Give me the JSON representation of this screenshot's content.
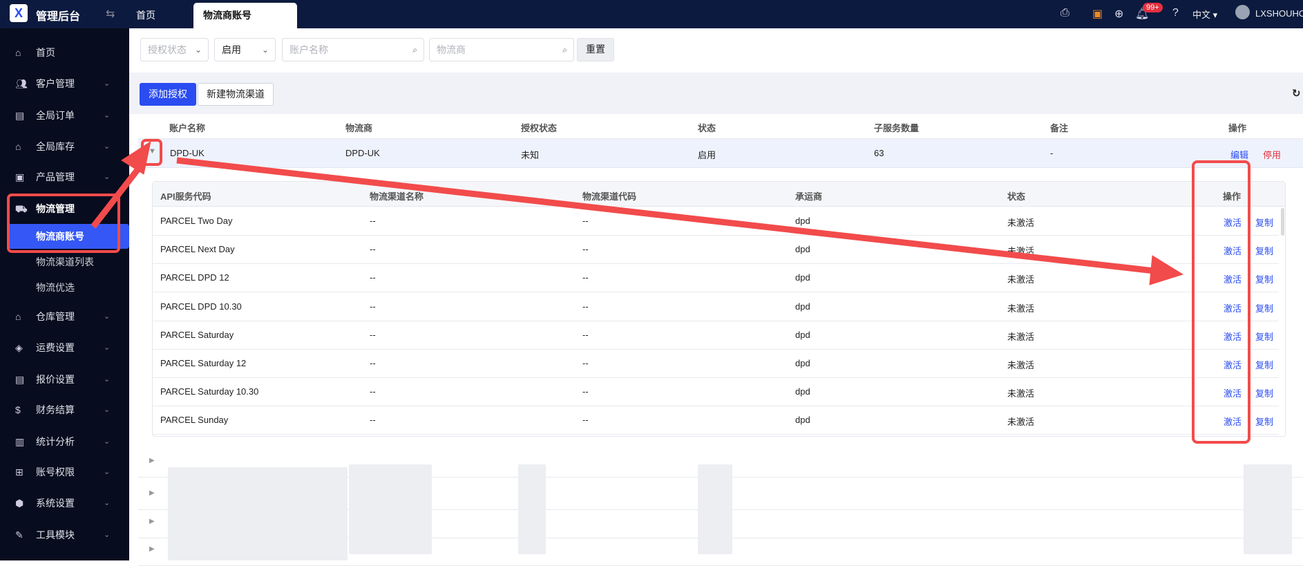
{
  "header": {
    "app_title": "管理后台",
    "tabs": [
      "首页",
      "物流商账号"
    ],
    "lang": "中文",
    "user": "LXSHOUHO",
    "notifications": "99+"
  },
  "sidebar": {
    "items": [
      {
        "label": "首页",
        "icon": "home-icon",
        "expandable": false
      },
      {
        "label": "客户管理",
        "icon": "users-icon",
        "expandable": true
      },
      {
        "label": "全局订单",
        "icon": "clipboard-icon",
        "expandable": true
      },
      {
        "label": "全局库存",
        "icon": "warehouse-icon",
        "expandable": true
      },
      {
        "label": "产品管理",
        "icon": "box-icon",
        "expandable": true
      },
      {
        "label": "物流管理",
        "icon": "truck-icon",
        "expandable": false,
        "children": [
          "物流商账号",
          "物流渠道列表",
          "物流优选"
        ]
      },
      {
        "label": "仓库管理",
        "icon": "house-icon",
        "expandable": true
      },
      {
        "label": "运费设置",
        "icon": "package-icon",
        "expandable": true
      },
      {
        "label": "报价设置",
        "icon": "document-icon",
        "expandable": true
      },
      {
        "label": "财务结算",
        "icon": "dollar-icon",
        "expandable": true
      },
      {
        "label": "统计分析",
        "icon": "chart-icon",
        "expandable": true
      },
      {
        "label": "账号权限",
        "icon": "org-icon",
        "expandable": true
      },
      {
        "label": "系统设置",
        "icon": "settings-icon",
        "expandable": true
      },
      {
        "label": "工具模块",
        "icon": "wrench-icon",
        "expandable": true
      }
    ]
  },
  "filters": {
    "auth_status_placeholder": "授权状态",
    "status_value": "启用",
    "account_placeholder": "账户名称",
    "carrier_placeholder": "物流商",
    "reset": "重置"
  },
  "toolbar": {
    "add": "添加授权",
    "new_channel": "新建物流渠道"
  },
  "table": {
    "columns": [
      "账户名称",
      "物流商",
      "授权状态",
      "状态",
      "子服务数量",
      "备注",
      "操作"
    ],
    "row": {
      "account": "DPD-UK",
      "carrier": "DPD-UK",
      "auth": "未知",
      "status": "启用",
      "count": "63",
      "note": "-",
      "edit": "编辑",
      "disable": "停用"
    }
  },
  "subtable": {
    "columns": [
      "API服务代码",
      "物流渠道名称",
      "物流渠道代码",
      "承运商",
      "状态",
      "操作"
    ],
    "activate": "激活",
    "copy": "复制",
    "rows": [
      [
        "PARCEL Two Day",
        "--",
        "--",
        "dpd",
        "未激活"
      ],
      [
        "PARCEL Next Day",
        "--",
        "--",
        "dpd",
        "未激活"
      ],
      [
        "PARCEL DPD 12",
        "--",
        "--",
        "dpd",
        "未激活"
      ],
      [
        "PARCEL DPD 10.30",
        "--",
        "--",
        "dpd",
        "未激活"
      ],
      [
        "PARCEL Saturday",
        "--",
        "--",
        "dpd",
        "未激活"
      ],
      [
        "PARCEL Saturday 12",
        "--",
        "--",
        "dpd",
        "未激活"
      ],
      [
        "PARCEL Saturday 10.30",
        "--",
        "--",
        "dpd",
        "未激活"
      ],
      [
        "PARCEL Sunday",
        "--",
        "--",
        "dpd",
        "未激活"
      ]
    ]
  },
  "colors": {
    "header": "#0b1a3e",
    "sidebar": "#070c1e",
    "accent": "#3457f5",
    "annotation": "#f24b4b",
    "danger": "#e5303f"
  }
}
